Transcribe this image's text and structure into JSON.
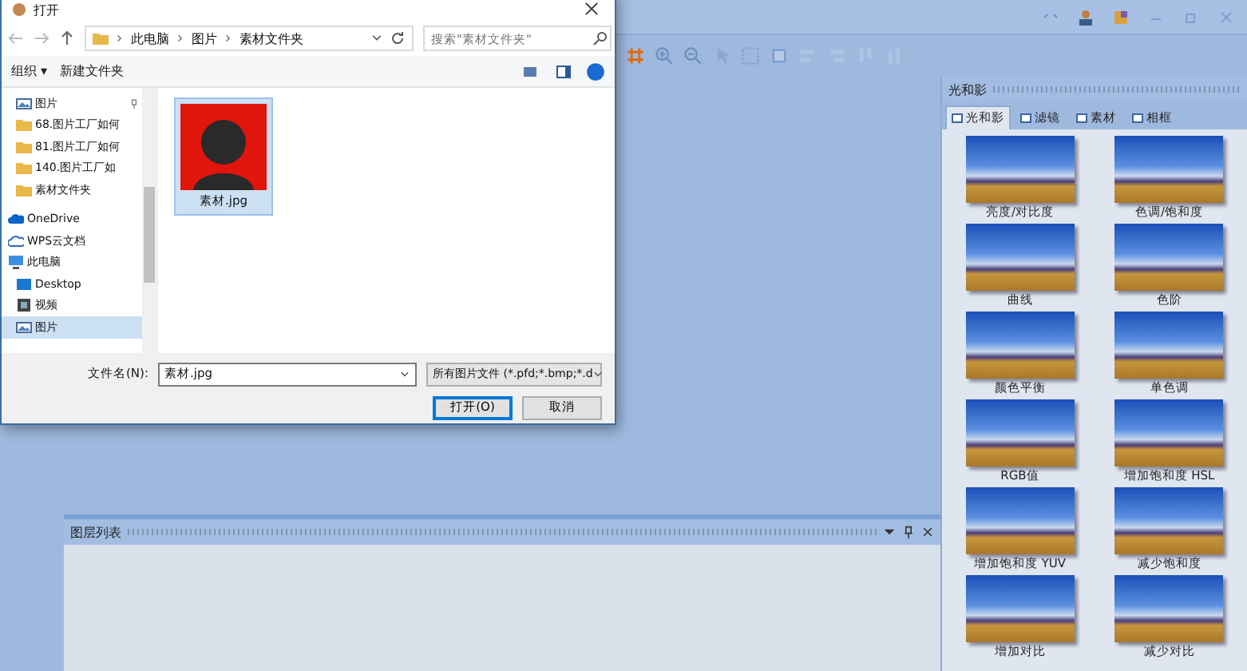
{
  "dialog": {
    "title": "打开",
    "breadcrumb": [
      "此电脑",
      "图片",
      "素材文件夹"
    ],
    "search": {
      "placeholder": "搜索\"素材文件夹\""
    },
    "toolbar": [
      "组织 ▾",
      "新建文件夹"
    ],
    "nav": [
      {
        "label": "图片",
        "kind": "pictures",
        "pinned": true,
        "selected": false
      },
      {
        "label": "68.图片工厂如何",
        "kind": "folder",
        "pinned": false,
        "selected": false
      },
      {
        "label": "81.图片工厂如何",
        "kind": "folder",
        "pinned": false,
        "selected": false
      },
      {
        "label": "140.图片工厂如",
        "kind": "folder",
        "pinned": false,
        "selected": false
      },
      {
        "label": "素材文件夹",
        "kind": "folder",
        "pinned": false,
        "selected": false
      },
      {
        "label": "OneDrive",
        "kind": "cloud",
        "pinned": false,
        "selected": false
      },
      {
        "label": "WPS云文档",
        "kind": "wps",
        "pinned": false,
        "selected": false
      },
      {
        "label": "此电脑",
        "kind": "pc",
        "pinned": false,
        "selected": false
      },
      {
        "label": "Desktop",
        "kind": "desktop",
        "pinned": false,
        "selected": false
      },
      {
        "label": "视频",
        "kind": "video",
        "pinned": false,
        "selected": false
      },
      {
        "label": "图片",
        "kind": "pictures",
        "pinned": false,
        "selected": true
      }
    ],
    "files": [
      {
        "name": "素材.jpg",
        "selected": true
      }
    ],
    "filename_label": "文件名(N):",
    "filename": "素材.jpg",
    "filter": "所有图片文件 (*.pfd;*.bmp;*.d",
    "buttons": [
      {
        "label": "打开(O)",
        "kind": "primary"
      },
      {
        "label": "取消",
        "kind": "normal"
      }
    ]
  },
  "side_panel": {
    "title": "光和影",
    "tabs": [
      {
        "label": "光和影",
        "selected": true
      },
      {
        "label": "滤镜",
        "selected": false
      },
      {
        "label": "素材",
        "selected": false
      },
      {
        "label": "相框",
        "selected": false
      }
    ],
    "effects": [
      "亮度/对比度",
      "色调/饱和度",
      "曲线",
      "色阶",
      "颜色平衡",
      "单色调",
      "RGB值",
      "增加饱和度 HSL",
      "增加饱和度 YUV",
      "减少饱和度",
      "增加对比",
      "减少对比"
    ]
  },
  "layers_panel": {
    "title": "图层列表"
  }
}
